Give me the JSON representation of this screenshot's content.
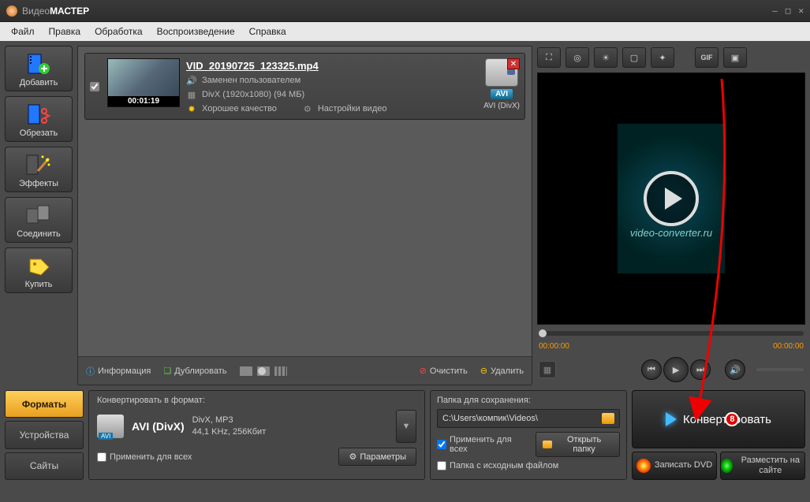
{
  "title": {
    "part1": "Видео",
    "part2": "МАСТЕР"
  },
  "menu": {
    "file": "Файл",
    "edit": "Правка",
    "process": "Обработка",
    "play": "Воспроизведение",
    "help": "Справка"
  },
  "sidebar": {
    "add": "Добавить",
    "trim": "Обрезать",
    "effects": "Эффекты",
    "join": "Соединить",
    "buy": "Купить"
  },
  "file": {
    "name": "VID_20190725_123325.mp4",
    "duration": "00:01:19",
    "audio_note": "Заменен пользователем",
    "format_info": "DivX (1920x1080) (94 МБ)",
    "quality": "Хорошее качество",
    "video_settings": "Настройки видео",
    "target_badge": "AVI",
    "target_sub": "AVI (DivX)"
  },
  "center_toolbar": {
    "info": "Информация",
    "duplicate": "Дублировать",
    "clear": "Очистить",
    "delete": "Удалить"
  },
  "preview": {
    "watermark": "video-converter.ru",
    "time_start": "00:00:00",
    "time_end": "00:00:00",
    "gif_label": "GIF"
  },
  "left_tabs": {
    "formats": "Форматы",
    "devices": "Устройства",
    "sites": "Сайты"
  },
  "format_box": {
    "header": "Конвертировать в формат:",
    "name": "AVI (DivX)",
    "badge": "AVI",
    "codec_line1": "DivX, MP3",
    "codec_line2": "44,1 KHz, 256Кбит",
    "apply_all": "Применить для всех",
    "params": "Параметры"
  },
  "save_box": {
    "header": "Папка для сохранения:",
    "path": "C:\\Users\\компик\\Videos\\",
    "apply_all": "Применить для всех",
    "source_folder": "Папка с исходным файлом",
    "open_folder": "Открыть папку"
  },
  "actions": {
    "convert": "Конвертировать",
    "dvd": "Записать DVD",
    "publish": "Разместить на сайте"
  },
  "annotation": {
    "marker": "8"
  }
}
